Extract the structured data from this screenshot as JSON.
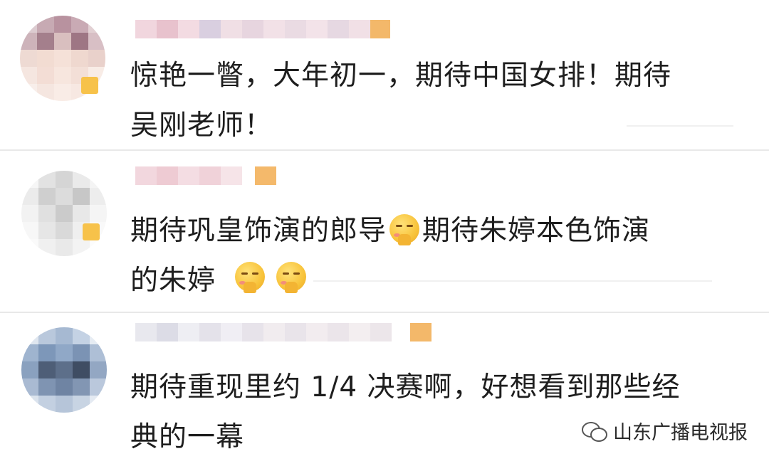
{
  "comments": [
    {
      "text": "惊艳一瞥，大年初一，期待中国女排！期待\n吴刚老师！",
      "avatar_colors": [
        "#c9b7bf",
        "#e5c9c4",
        "#b99aa5",
        "#efd8cf",
        "#d8c1c0",
        "#f2e1db",
        "#cfb2b6",
        "#e9d4cd",
        "#f5e4dc"
      ]
    },
    {
      "text_part1": "期待巩皇饰演的郎导",
      "text_part2": "期待朱婷本色饰演\n的朱婷",
      "avatar_colors": [
        "#eeeeee",
        "#d9d9d9",
        "#f4f4f4",
        "#cfcfcf",
        "#e6e6e6",
        "#dedede",
        "#f7f7f7",
        "#e3e3e3",
        "#ececec"
      ]
    },
    {
      "text": "期待重现里约 1/4 决赛啊，好想看到那些经\n典的一幕",
      "avatar_colors": [
        "#9fb5d1",
        "#c9d6e6",
        "#7f96b6",
        "#b3c4db",
        "#5f708c",
        "#a7b9d2",
        "#cdd8e6",
        "#8ea3c1",
        "#dce4ef"
      ]
    }
  ],
  "watermark": {
    "text": "山东广播电视报",
    "icon": "wechat-icon"
  }
}
